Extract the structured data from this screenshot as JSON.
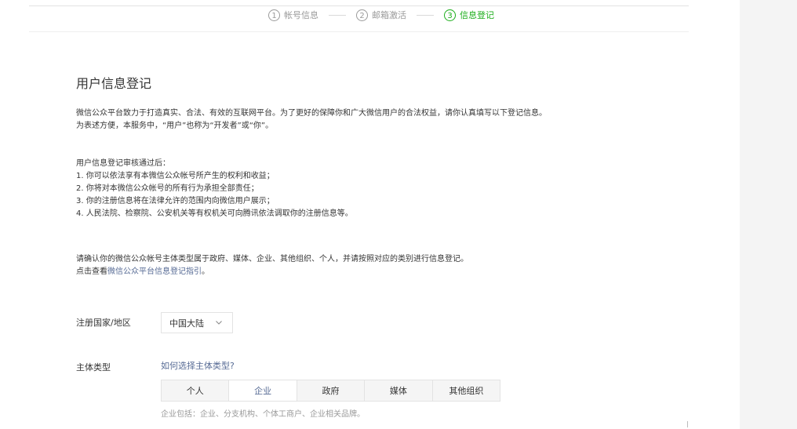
{
  "stepper": {
    "steps": [
      {
        "num": "1",
        "label": "帐号信息"
      },
      {
        "num": "2",
        "label": "邮箱激活"
      },
      {
        "num": "3",
        "label": "信息登记"
      }
    ],
    "active_color": "#1aad19"
  },
  "page": {
    "title": "用户信息登记",
    "intro": [
      "微信公众平台致力于打造真实、合法、有效的互联网平台。为了更好的保障你和广大微信用户的合法权益，请你认真填写以下登记信息。",
      "为表述方便，本服务中，“用户”也称为“开发者”或“你”。"
    ],
    "after_heading": "用户信息登记审核通过后：",
    "after_items": [
      "1. 你可以依法享有本微信公众帐号所产生的权利和收益；",
      "2. 你将对本微信公众帐号的所有行为承担全部责任；",
      "3. 你的注册信息将在法律允许的范围内向微信用户展示；",
      "4. 人民法院、检察院、公安机关等有权机关可向腾讯依法调取你的注册信息等。"
    ],
    "confirm_text": "请确认你的微信公众帐号主体类型属于政府、媒体、企业、其他组织、个人，并请按照对应的类别进行信息登记。",
    "guide_prefix": "点击查看",
    "guide_link": "微信公众平台信息登记指引",
    "guide_suffix": "。"
  },
  "form": {
    "region_label": "注册国家/地区",
    "region_value": "中国大陆",
    "type_label": "主体类型",
    "type_help": "如何选择主体类型?",
    "type_options": [
      "个人",
      "企业",
      "政府",
      "媒体",
      "其他组织"
    ],
    "type_selected": "企业",
    "type_note": "企业包括：企业、分支机构、个体工商户、企业相关品牌。"
  },
  "colors": {
    "link": "#576b95",
    "text": "#353535",
    "muted": "#9a9a9a",
    "side_panel": "#f4f4f4"
  },
  "icons": {
    "region_dropdown": "chevron-down-icon"
  }
}
